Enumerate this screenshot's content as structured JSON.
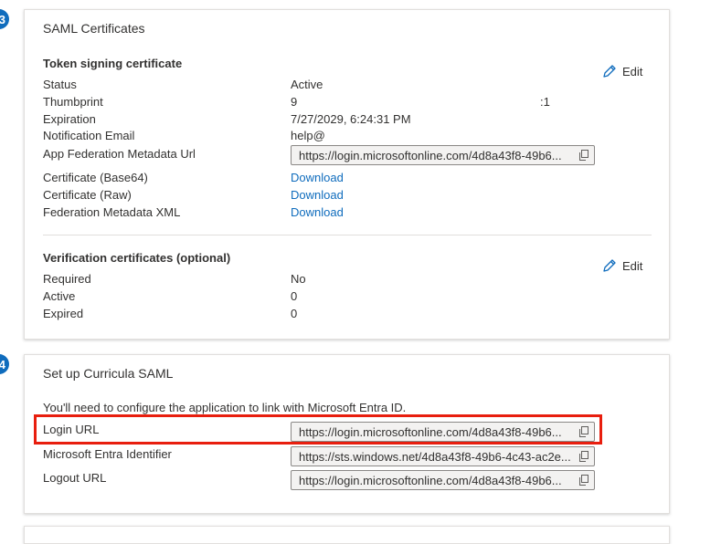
{
  "colors": {
    "accent": "#0f6cbd",
    "highlight": "#e81e0e",
    "field_bg": "#f3f2f1"
  },
  "steps": {
    "step3": "3",
    "step4": "4"
  },
  "saml_certificates": {
    "title": "SAML Certificates",
    "token_signing": {
      "heading": "Token signing certificate",
      "edit_label": "Edit",
      "status_label": "Status",
      "status_value": "Active",
      "thumbprint_label": "Thumbprint",
      "thumbprint_start": "9",
      "thumbprint_end": ":1",
      "expiration_label": "Expiration",
      "expiration_value": "7/27/2029, 6:24:31 PM",
      "notification_email_label": "Notification Email",
      "notification_email_value": "help@",
      "metadata_url_label": "App Federation Metadata Url",
      "metadata_url_value": "https://login.microsoftonline.com/4d8a43f8-49b6...",
      "cert_base64_label": "Certificate (Base64)",
      "cert_raw_label": "Certificate (Raw)",
      "federation_xml_label": "Federation Metadata XML",
      "download_label": "Download"
    },
    "verification": {
      "heading": "Verification certificates (optional)",
      "edit_label": "Edit",
      "required_label": "Required",
      "required_value": "No",
      "active_label": "Active",
      "active_value": "0",
      "expired_label": "Expired",
      "expired_value": "0"
    }
  },
  "setup": {
    "title": "Set up Curricula SAML",
    "description": "You'll need to configure the application to link with Microsoft Entra ID.",
    "login_url_label": "Login URL",
    "login_url_value": "https://login.microsoftonline.com/4d8a43f8-49b6...",
    "entra_identifier_label": "Microsoft Entra Identifier",
    "entra_identifier_value": "https://sts.windows.net/4d8a43f8-49b6-4c43-ac2e...",
    "logout_url_label": "Logout URL",
    "logout_url_value": "https://login.microsoftonline.com/4d8a43f8-49b6..."
  }
}
